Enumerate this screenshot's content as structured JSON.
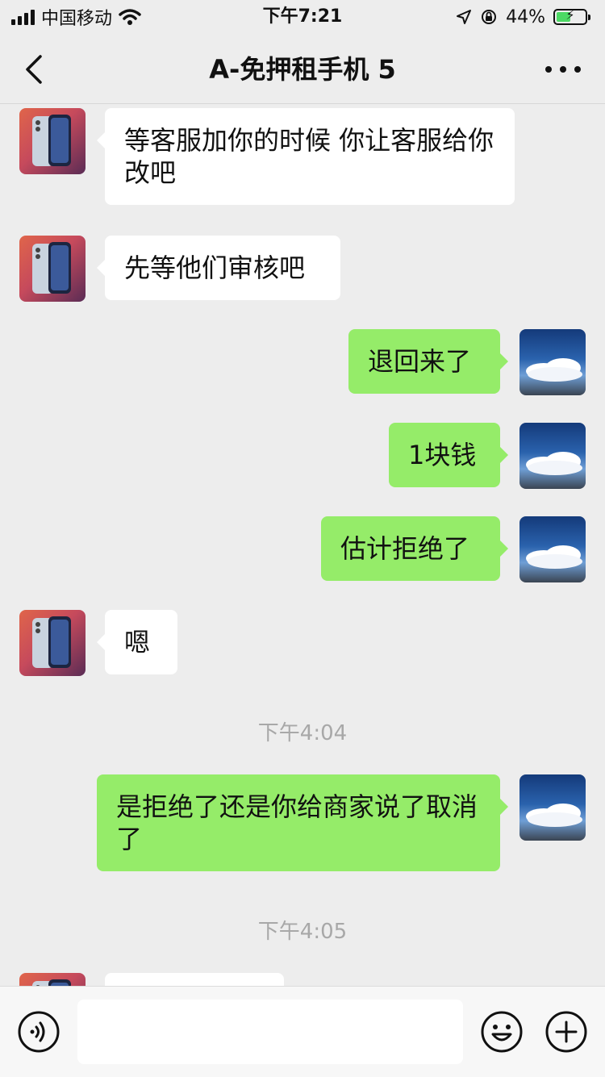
{
  "status_bar": {
    "carrier": "中国移动",
    "time": "下午7:21",
    "battery_percent": "44%",
    "icons": [
      "signal-icon",
      "wifi-icon",
      "location-icon",
      "rotation-lock-icon",
      "battery-charging-icon"
    ]
  },
  "header": {
    "title": "A-免押租手机 5",
    "icons": [
      "back-icon",
      "more-icon"
    ]
  },
  "messages": [
    {
      "side": "left",
      "avatar": "phone-avatar",
      "text": "等客服加你的时候 你让客服给你改吧"
    },
    {
      "side": "left",
      "avatar": "phone-avatar",
      "text": "先等他们审核吧"
    },
    {
      "side": "right",
      "avatar": "sky-avatar",
      "text": "退回来了"
    },
    {
      "side": "right",
      "avatar": "sky-avatar",
      "text": "1块钱"
    },
    {
      "side": "right",
      "avatar": "sky-avatar",
      "text": "估计拒绝了"
    },
    {
      "side": "left",
      "avatar": "phone-avatar",
      "text": "嗯"
    },
    {
      "side": "right",
      "avatar": "sky-avatar",
      "text": "是拒绝了还是你给商家说了取消了"
    },
    {
      "side": "left",
      "avatar": "phone-avatar",
      "text": ""
    }
  ],
  "timestamps": [
    "下午4:04",
    "下午4:05"
  ],
  "input_bar": {
    "input_value": "",
    "icons": [
      "voice-icon",
      "emoji-icon",
      "plus-icon"
    ]
  },
  "colors": {
    "background": "#ededed",
    "bubble_sent": "#95ec69",
    "bubble_received": "#ffffff",
    "timestamp_text": "#a8a8a8"
  }
}
